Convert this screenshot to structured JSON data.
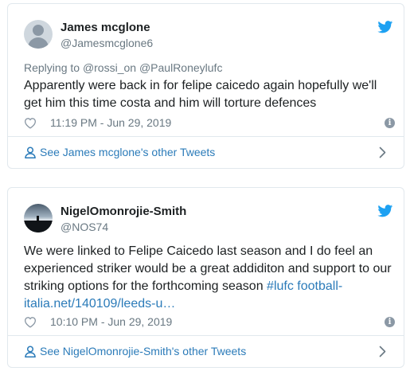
{
  "tweets": [
    {
      "author_name": "James mcglone",
      "author_handle": "@Jamesmcglone6",
      "reply_prefix": "Replying to ",
      "reply_to": "@rossi_on @PaulRoneylufc",
      "text": "Apparently were back in for felipe caicedo again hopefully we'll get him this time costa and him will torture defences",
      "timestamp": "11:19 PM - Jun 29, 2019",
      "footer_link": "See James mcglone's other Tweets",
      "avatar": "default-avatar-icon"
    },
    {
      "author_name": "NigelOmonrojie-Smith",
      "author_handle": "@NOS74",
      "text_plain": "We were linked to Felipe Caicedo last season and I do feel an experienced striker would be a great addiditon and support to our striking options for the forthcoming season ",
      "hashtag": "#lufc",
      "link": "football-italia.net/140109/leeds-u…",
      "timestamp": "10:10 PM - Jun 29, 2019",
      "footer_link": "See NigelOmonrojie-Smith's other Tweets",
      "avatar": "photo-avatar"
    }
  ],
  "icons": {
    "brand": "twitter-bird-icon",
    "like": "heart-icon",
    "info": "info-icon",
    "profile": "person-icon",
    "more": "chevron-right-icon"
  },
  "colors": {
    "twitter_blue": "#1da1f2",
    "link_blue": "#2b7bb9",
    "muted": "#697882",
    "border": "#e1e8ed"
  }
}
